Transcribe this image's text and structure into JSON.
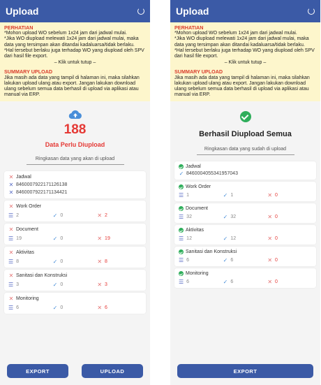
{
  "left": {
    "appbar": {
      "title": "Upload",
      "refresh_icon": "refresh-icon"
    },
    "notice": {
      "heading": "PERHATIAN",
      "line1": "*Mohon upload WO sebelum 1x24 jam dari jadwal mulai.",
      "line2": "*Jika WO diupload melewati 1x24 jam dari jadwal mulai, maka data yang tersimpan akan ditandai kadaluarsa/tidak berlaku.",
      "line3": "*Hal tersebut berlaku juga terhadap WO yang diupload oleh SPV dari hasil file export.",
      "close_hint": "– Klik untuk tutup –",
      "summary_heading": "SUMMARY UPLOAD",
      "summary_text": "Jika masih ada data yang tampil di halaman ini, maka silahkan lakukan upload ulang atau export. Jangan lakukan download ulang sebelum semua data berhasil di upload via aplikasi atau manual via ERP."
    },
    "count": "188",
    "count_label": "Data Perlu Diupload",
    "summary_caption": "Ringkasan data yang akan di upload",
    "jadwal": {
      "name": "Jadwal",
      "ids": [
        "8460007922171126138",
        "8460007922171134421"
      ]
    },
    "items": [
      {
        "name": "Work Order",
        "total": "2",
        "ok": "0",
        "fail": "2"
      },
      {
        "name": "Document",
        "total": "19",
        "ok": "0",
        "fail": "19"
      },
      {
        "name": "Aktivitas",
        "total": "8",
        "ok": "0",
        "fail": "8"
      },
      {
        "name": "Sanitasi dan Konstruksi",
        "total": "3",
        "ok": "0",
        "fail": "3"
      },
      {
        "name": "Monitoring",
        "total": "6",
        "ok": "0",
        "fail": "6"
      }
    ],
    "buttons": {
      "export": "EXPORT",
      "upload": "UPLOAD"
    }
  },
  "right": {
    "appbar": {
      "title": "Upload",
      "refresh_icon": "refresh-icon"
    },
    "notice": {
      "heading": "PERHATIAN",
      "line1": "*Mohon upload WO sebelum 1x24 jam dari jadwal mulai.",
      "line2": "*Jika WO diupload melewati 1x24 jam dari jadwal mulai, maka data yang tersimpan akan ditandai kadaluarsa/tidak berlaku.",
      "line3": "*Hal tersebut berlaku juga terhadap WO yang diupload oleh SPV dari hasil file export.",
      "close_hint": "– Klik untuk tutup –",
      "summary_heading": "SUMMARY UPLOAD",
      "summary_text": "Jika masih ada data yang tampil di halaman ini, maka silahkan lakukan upload ulang atau export. Jangan lakukan download ulang sebelum semua data berhasil di upload via aplikasi atau manual via ERP."
    },
    "success_title": "Berhasil Diupload Semua",
    "summary_caption": "Ringkasan data yang sudah di upload",
    "jadwal": {
      "name": "Jadwal",
      "id": "8460004055341957043"
    },
    "items": [
      {
        "name": "Work Order",
        "total": "1",
        "ok": "1",
        "fail": "0"
      },
      {
        "name": "Document",
        "total": "32",
        "ok": "32",
        "fail": "0"
      },
      {
        "name": "Aktivitas",
        "total": "12",
        "ok": "12",
        "fail": "0"
      },
      {
        "name": "Sanitasi dan Konstruksi",
        "total": "6",
        "ok": "6",
        "fail": "0"
      },
      {
        "name": "Monitoring",
        "total": "6",
        "ok": "6",
        "fail": "0"
      }
    ],
    "buttons": {
      "export": "EXPORT"
    }
  },
  "colors": {
    "primary": "#3b5aa6",
    "notice_bg": "#fdf6cc",
    "error": "#e53935",
    "success": "#2fae5b"
  }
}
